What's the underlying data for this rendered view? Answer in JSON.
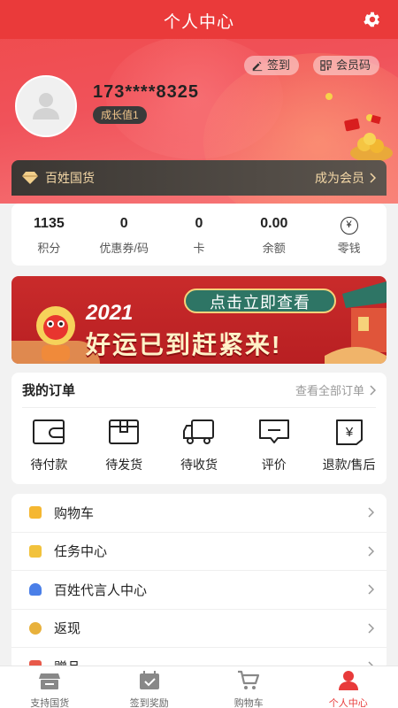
{
  "topbar": {
    "title": "个人中心",
    "settings_icon": "gear-icon"
  },
  "actions": {
    "checkin_label": "签到",
    "member_code_label": "会员码"
  },
  "profile": {
    "phone": "173****8325",
    "growth_label": "成长值1"
  },
  "vip": {
    "brand": "百姓国货",
    "become_label": "成为会员"
  },
  "stats": [
    {
      "value": "1135",
      "label": "积分"
    },
    {
      "value": "0",
      "label": "优惠券/码"
    },
    {
      "value": "0",
      "label": "卡"
    },
    {
      "value": "0.00",
      "label": "余额"
    },
    {
      "value": "¥",
      "label": "零钱"
    }
  ],
  "banner": {
    "button": "点击立即查看",
    "year": "2021",
    "slogan": "好运已到赶紧来!"
  },
  "orders": {
    "title": "我的订单",
    "view_all": "查看全部订单",
    "items": [
      {
        "label": "待付款",
        "icon": "wallet-icon"
      },
      {
        "label": "待发货",
        "icon": "box-icon"
      },
      {
        "label": "待收货",
        "icon": "truck-icon"
      },
      {
        "label": "评价",
        "icon": "comment-icon"
      },
      {
        "label": "退款/售后",
        "icon": "refund-icon"
      }
    ]
  },
  "menu": [
    {
      "label": "购物车",
      "color": "#f5b731"
    },
    {
      "label": "任务中心",
      "color": "#f2c23c"
    },
    {
      "label": "百姓代言人中心",
      "color": "#4a7fe8"
    },
    {
      "label": "返现",
      "color": "#e8b13c"
    },
    {
      "label": "赠品",
      "color": "#e85a4a"
    }
  ],
  "tabbar": [
    {
      "label": "支持国货",
      "icon": "store-icon",
      "active": false
    },
    {
      "label": "签到奖励",
      "icon": "calendar-check-icon",
      "active": false
    },
    {
      "label": "购物车",
      "icon": "cart-icon",
      "active": false
    },
    {
      "label": "个人中心",
      "icon": "person-icon",
      "active": true
    }
  ],
  "colors": {
    "brand_red": "#ea3a3a",
    "gold": "#f4d8a7",
    "active_tab": "#e83a3a"
  }
}
